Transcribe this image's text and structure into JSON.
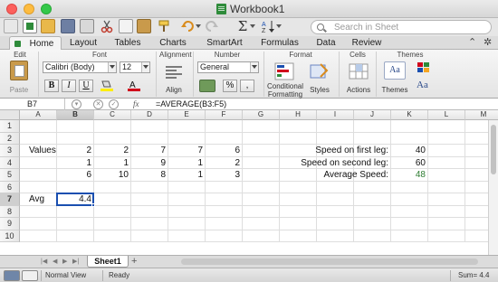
{
  "window": {
    "title": "Workbook1"
  },
  "search": {
    "placeholder": "Search in Sheet"
  },
  "tabs": [
    "Home",
    "Layout",
    "Tables",
    "Charts",
    "SmartArt",
    "Formulas",
    "Data",
    "Review"
  ],
  "ribbon": {
    "groups": {
      "edit": "Edit",
      "font": "Font",
      "alignment": "Alignment",
      "number": "Number",
      "format": "Format",
      "cells": "Cells",
      "themes": "Themes"
    },
    "paste_label": "Paste",
    "font_name": "Calibri (Body)",
    "font_size": "12",
    "bold": "B",
    "italic": "I",
    "underline": "U",
    "align_label": "Align",
    "number_format": "General",
    "percent": "%",
    "comma": ",",
    "cond_format_label_1": "Conditional",
    "cond_format_label_2": "Formatting",
    "styles_label": "Styles",
    "actions_label": "Actions",
    "themes_label": "Themes",
    "themes_preview": "Aa",
    "font_preview": "Aa"
  },
  "formula_bar": {
    "name_box": "B7",
    "fx": "fx",
    "formula": "=AVERAGE(B3:F5)"
  },
  "columns": [
    "A",
    "B",
    "C",
    "D",
    "E",
    "F",
    "G",
    "H",
    "I",
    "J",
    "K",
    "L",
    "M"
  ],
  "rows": [
    "1",
    "2",
    "3",
    "4",
    "5",
    "6",
    "7",
    "8",
    "9",
    "10"
  ],
  "cells": {
    "A3": "Values",
    "B3": "2",
    "C3": "2",
    "D3": "7",
    "E3": "7",
    "F3": "6",
    "B4": "1",
    "C4": "1",
    "D4": "9",
    "E4": "1",
    "F4": "2",
    "B5": "6",
    "C5": "10",
    "D5": "8",
    "E5": "1",
    "F5": "3",
    "A7": "Avg",
    "B7": "4.4",
    "H3": "Speed  on first leg:",
    "K3": "40",
    "H4": "Speed on second leg:",
    "K4": "60",
    "H5": "Average Speed:",
    "K5": "48"
  },
  "colors": {
    "selection": "#1a4fb0",
    "accent_green": "#2e8b3a",
    "result_green": "#2e7d32"
  },
  "sheet_tabs": [
    "Sheet1"
  ],
  "status": {
    "view": "Normal View",
    "state": "Ready",
    "sum": "Sum= 4.4"
  }
}
